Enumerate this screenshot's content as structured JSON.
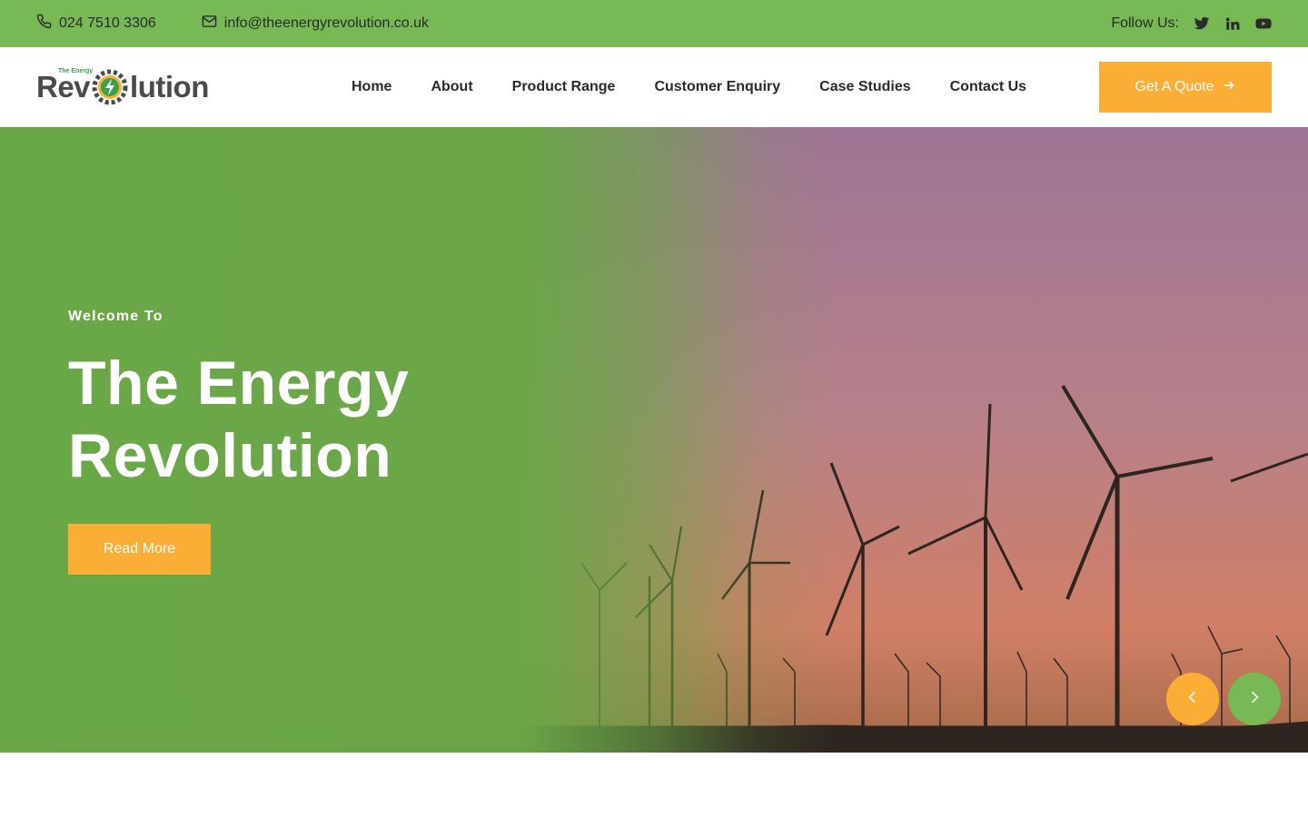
{
  "topbar": {
    "phone": "024 7510 3306",
    "email": "info@theenergyrevolution.co.uk",
    "follow_label": "Follow Us:",
    "social": [
      "twitter-icon",
      "linkedin-icon",
      "youtube-icon"
    ]
  },
  "logo": {
    "small_text": "The Energy",
    "part1": "Rev",
    "part2": "lution"
  },
  "nav": {
    "items": [
      "Home",
      "About",
      "Product Range",
      "Customer Enquiry",
      "Case Studies",
      "Contact Us"
    ],
    "quote_label": "Get A Quote"
  },
  "hero": {
    "welcome": "Welcome To",
    "title_line1": "The Energy",
    "title_line2": "Revolution",
    "button_label": "Read More"
  },
  "colors": {
    "green": "#77b955",
    "orange": "#fbae35",
    "text_dark": "#2b2b2b"
  }
}
